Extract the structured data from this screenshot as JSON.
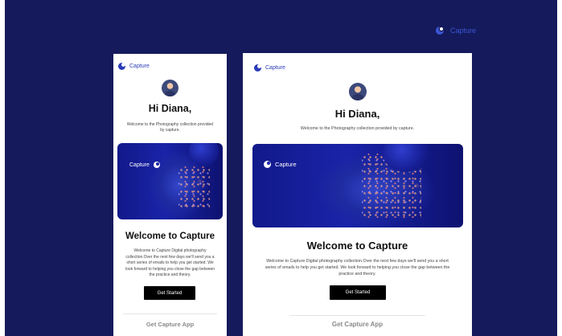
{
  "brand": {
    "name": "Capture",
    "accent": "#3d56d6",
    "background": "#141a5b"
  },
  "email": {
    "brand_name": "Capture",
    "greeting": "Hi Diana,",
    "intro": "Welcome to the Photography collection provided by capture.",
    "hero_brand": "Capture",
    "headline": "Welcome to Capture",
    "body": "Welcome to Capture Digital photography collection.Over the next few days we'll send you a short series of emails to help you get started. We look forward to helping you close the gap between the practice and theory.",
    "cta_label": "Get Started",
    "app_section_title": "Get Capture App"
  },
  "icons": {
    "logo": "capture-logo-icon",
    "avatar": "user-avatar"
  }
}
